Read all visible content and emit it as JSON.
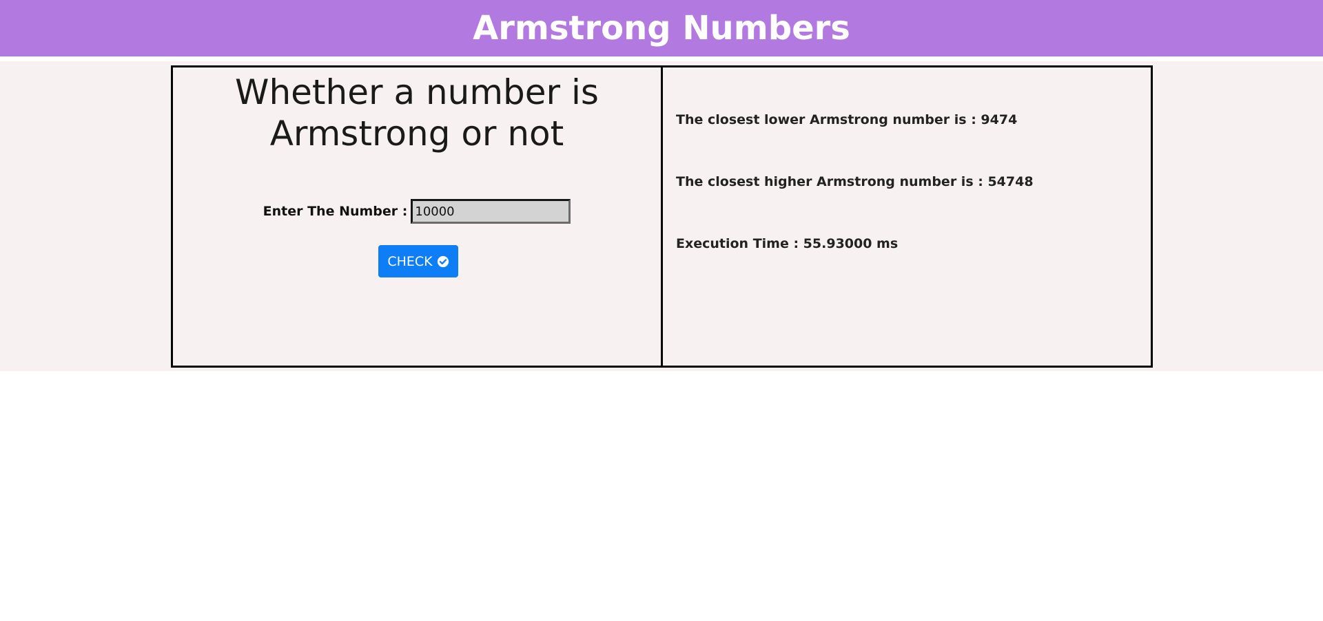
{
  "header": {
    "title": "Armstrong Numbers",
    "background_color": "#b27ae0"
  },
  "check_panel": {
    "heading_line1": "Whether a number is",
    "heading_line2": "Armstrong or not",
    "input_label": "Enter The Number :",
    "input_value": "10000",
    "button_label": "CHECK",
    "button_icon": "check-circle-icon",
    "button_color": "#0d7ef6"
  },
  "results": {
    "closest_lower": "The closest lower Armstrong number is : 9474",
    "closest_higher": "The closest higher Armstrong number is : 54748",
    "execution_time": "Execution Time : 55.93000 ms"
  }
}
